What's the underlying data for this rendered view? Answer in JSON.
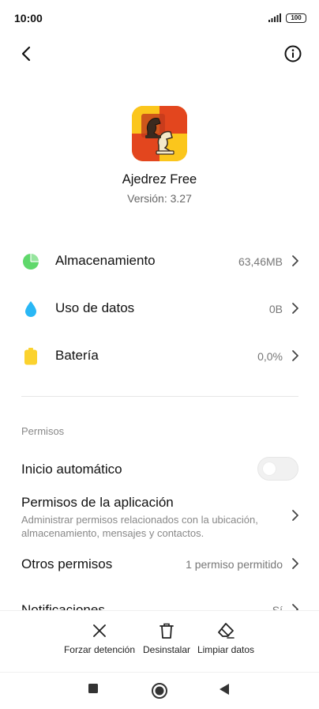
{
  "status_bar": {
    "time": "10:00",
    "battery": "100"
  },
  "app": {
    "name": "Ajedrez Free",
    "version": "Versión: 3.27"
  },
  "stats": [
    {
      "label": "Almacenamiento",
      "value": "63,46MB",
      "icon": "storage-pie-icon",
      "color": "#5fd86b"
    },
    {
      "label": "Uso de datos",
      "value": "0B",
      "icon": "water-drop-icon",
      "color": "#29b7f5"
    },
    {
      "label": "Batería",
      "value": "0,0%",
      "icon": "battery-icon",
      "color": "#fbd22e"
    }
  ],
  "permissions": {
    "section_label": "Permisos",
    "autostart": {
      "label": "Inicio automático",
      "enabled": false
    },
    "app_permissions": {
      "title": "Permisos de la aplicación",
      "description": "Administrar permisos relacionados con la ubicación, almacenamiento, mensajes y contactos."
    },
    "other_permissions": {
      "title": "Otros permisos",
      "value": "1 permiso permitido"
    },
    "notifications": {
      "title": "Notificaciones",
      "value": "Sí"
    }
  },
  "actions": [
    {
      "label": "Forzar detención",
      "icon": "close-x-icon"
    },
    {
      "label": "Desinstalar",
      "icon": "trash-icon"
    },
    {
      "label": "Limpiar datos",
      "icon": "eraser-icon"
    }
  ],
  "nav": {
    "recents": "square-icon",
    "home": "circle-icon",
    "back": "triangle-back-icon"
  }
}
